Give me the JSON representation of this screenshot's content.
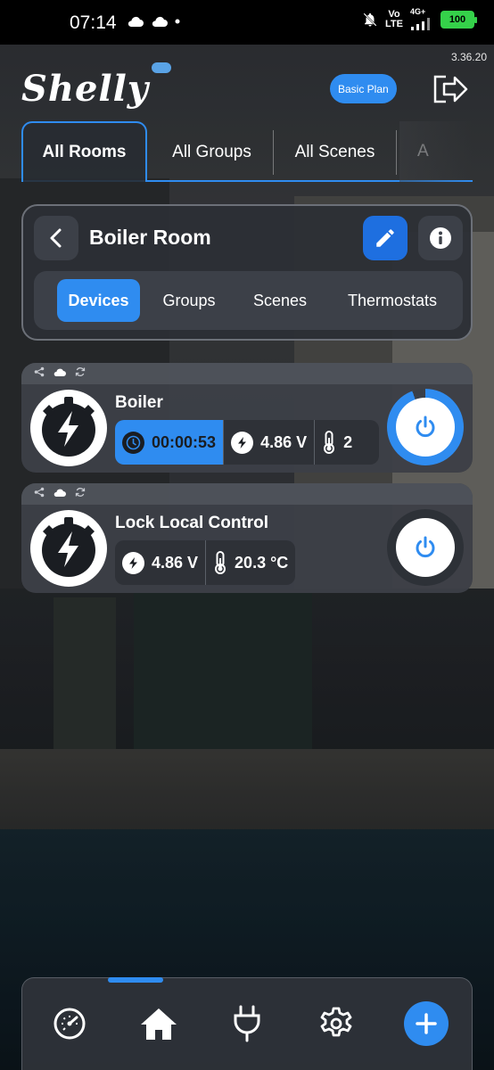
{
  "status_bar": {
    "time": "07:14",
    "icons": [
      "cloud-icon",
      "cloud-icon",
      "dot-icon"
    ],
    "right_icons": [
      "bell-off-icon",
      "volte-icon",
      "signal-icon",
      "battery-icon"
    ],
    "volte_top": "Vo",
    "volte_bottom": "LTE",
    "network": "4G+",
    "battery": "100"
  },
  "version": "3.36.20",
  "header": {
    "logo_text": "Shelly",
    "plan_label": "Basic Plan",
    "logout_icon": "logout-icon"
  },
  "tabs": [
    {
      "label": "All Rooms",
      "active": true
    },
    {
      "label": "All Groups",
      "active": false
    },
    {
      "label": "All Scenes",
      "active": false
    },
    {
      "label": "A",
      "active": false
    }
  ],
  "room": {
    "title": "Boiler Room",
    "back_icon": "chevron-left-icon",
    "edit_icon": "pencil-icon",
    "info_icon": "info-icon",
    "subtabs": [
      {
        "label": "Devices",
        "active": true
      },
      {
        "label": "Groups",
        "active": false
      },
      {
        "label": "Scenes",
        "active": false
      },
      {
        "label": "Thermostats",
        "active": false
      }
    ]
  },
  "devices": [
    {
      "name": "Boiler",
      "icon": "lightning-icon",
      "status_icons": [
        "share-icon",
        "cloud-icon",
        "sync-icon"
      ],
      "timer": "00:00:53",
      "voltage": "4.86 V",
      "temperature_partial": "2",
      "power_on": true,
      "colors": {
        "accent": "#2f8cf0"
      }
    },
    {
      "name": "Lock Local Control",
      "icon": "lightning-icon",
      "status_icons": [
        "share-icon",
        "cloud-icon",
        "sync-icon"
      ],
      "voltage": "4.86 V",
      "temperature": "20.3 °C",
      "power_on": false
    }
  ],
  "bottom_nav": {
    "items": [
      "dashboard-icon",
      "home-icon",
      "plug-icon",
      "gear-icon",
      "plus-icon"
    ],
    "active": "home-icon"
  },
  "colors": {
    "accent": "#2f8cf0",
    "card": "#3c4048",
    "battery": "#35d14a"
  }
}
